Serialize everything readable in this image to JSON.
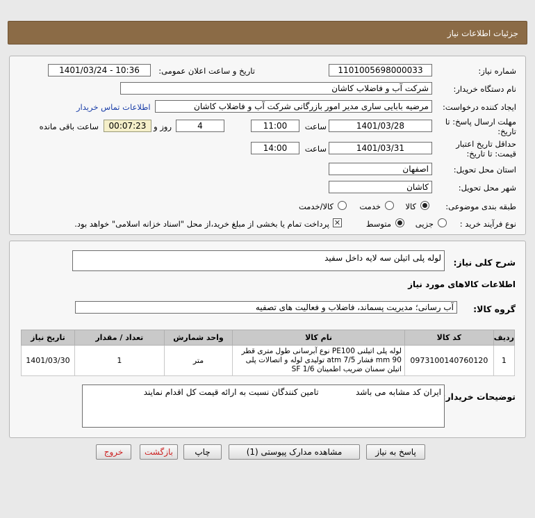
{
  "header": {
    "title": "جزئیات اطلاعات نیاز"
  },
  "form": {
    "need_number_label": "شماره نیاز:",
    "need_number": "1101005698000033",
    "announce_label": "تاریخ و ساعت اعلان عمومی:",
    "announce_value": "1401/03/24 - 10:36",
    "buyer_org_label": "نام دستگاه خریدار:",
    "buyer_org": "شرکت آب و فاضلاب کاشان",
    "creator_label": "ایجاد کننده درخواست:",
    "creator": "مرضیه بابایی ساری مدیر امور بازرگانی شرکت آب و فاضلاب کاشان",
    "contact_link": "اطلاعات تماس خریدار",
    "deadline_label_1": "مهلت ارسال پاسخ: تا",
    "deadline_label_2": "تاریخ:",
    "deadline_date": "1401/03/28",
    "time_label": "ساعت",
    "deadline_time": "11:00",
    "days_value": "4",
    "days_label": "روز و",
    "remaining_time": "00:07:23",
    "remaining_label": "ساعت باقی مانده",
    "validity_label_1": "حداقل تاریخ اعتبار",
    "validity_label_2": "قیمت: تا تاریخ:",
    "validity_date": "1401/03/31",
    "validity_time_label": "ساعت",
    "validity_time": "14:00",
    "province_label": "استان محل تحویل:",
    "province": "اصفهان",
    "city_label": "شهر محل تحویل:",
    "city": "کاشان",
    "category_label": "طبقه بندی موضوعی:",
    "category_options": [
      "کالا",
      "خدمت",
      "کالا/خدمت"
    ],
    "category_selected": "کالا",
    "process_label": "نوع فرآیند خرید :",
    "process_options": [
      "جزیی",
      "متوسط"
    ],
    "process_selected": "متوسط",
    "payment_note": "پرداخت تمام یا بخشی از مبلغ خرید،از محل \"اسناد خزانه اسلامی\" خواهد بود."
  },
  "summary": {
    "desc_label": "شرح کلی نیاز:",
    "desc_value": "لوله پلی اتیلن سه لایه داخل سفید",
    "goods_info_title": "اطلاعات کالاهای مورد نیاز",
    "group_label": "گروه کالا:",
    "group_value": "آب رسانی؛ مدیریت پسماند، فاضلاب و فعالیت های تصفیه"
  },
  "table": {
    "headers": [
      "ردیف",
      "کد کالا",
      "نام کالا",
      "واحد شمارش",
      "تعداد / مقدار",
      "تاریخ نیاز"
    ],
    "rows": [
      {
        "row": "1",
        "code": "0973100140760120",
        "name": "لوله پلی اتیلنی PE100 نوع آبرسانی طول متری قطر mm 90 فشار atm 7/5 تولیدی لوله و اتصالات پلی اتیلن سمنان ضریب اطمینان SF 1/6",
        "unit": "متر",
        "qty": "1",
        "date": "1401/03/30"
      }
    ]
  },
  "buyer_notes": {
    "label": "توضیحات خریدار:",
    "text": "ایران کد مشابه می باشد              تامین کنندگان نسبت به ارائه قیمت کل اقدام نمایند"
  },
  "buttons": {
    "reply": "پاسخ به نیاز",
    "attachments": "مشاهده مدارک پیوستی (1)",
    "print": "چاپ",
    "back": "بازگشت",
    "exit": "خروج"
  },
  "colors": {
    "header_bg": "#8b6b46",
    "link": "#1a3ea8",
    "back_exit_text": "#c22222"
  }
}
